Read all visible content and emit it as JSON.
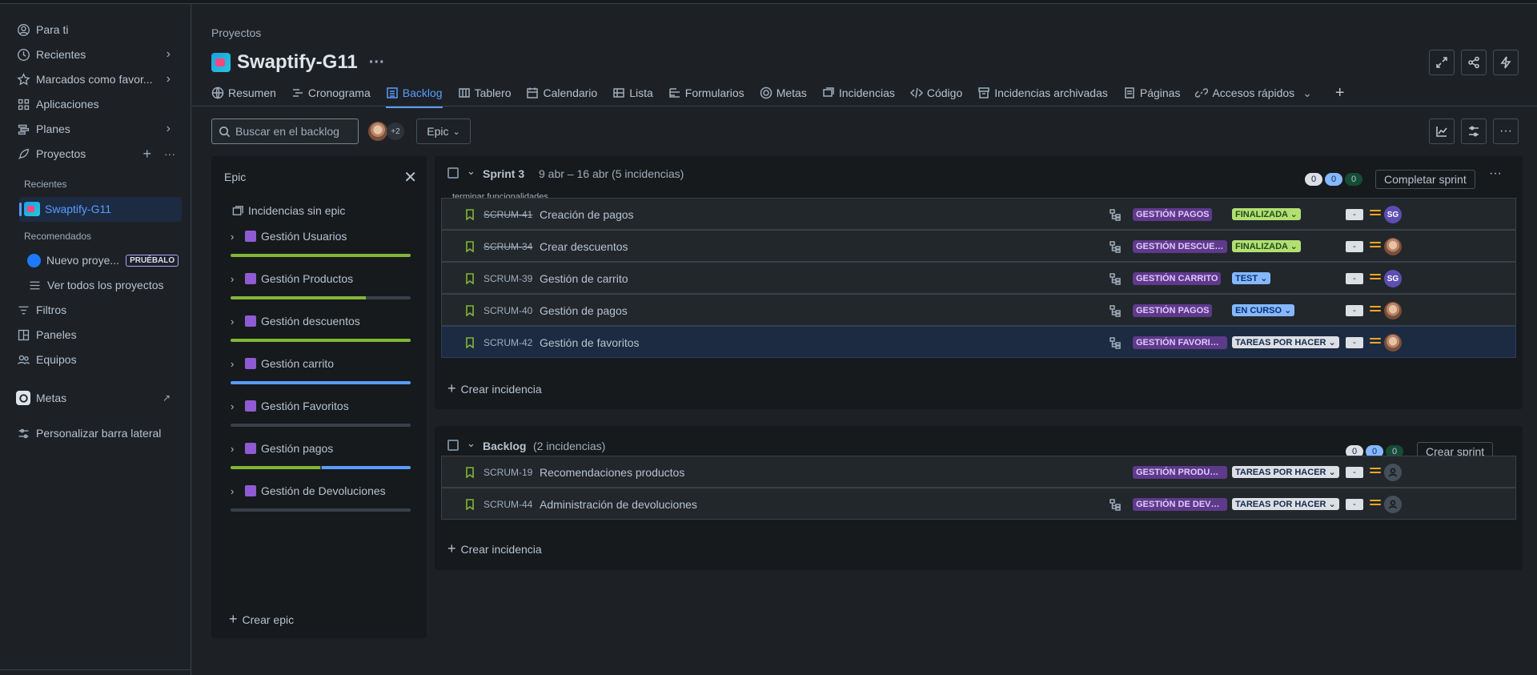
{
  "sidebar": {
    "items": [
      {
        "label": "Para ti",
        "icon": "user-circle-icon"
      },
      {
        "label": "Recientes",
        "icon": "clock-icon"
      },
      {
        "label": "Marcados como favor...",
        "icon": "star-icon"
      },
      {
        "label": "Aplicaciones",
        "icon": "apps-icon"
      },
      {
        "label": "Planes",
        "icon": "plans-icon"
      },
      {
        "label": "Proyectos",
        "icon": "rocket-icon"
      }
    ],
    "recent_label": "Recientes",
    "current_project": "Swaptify-G11",
    "recommended_label": "Recomendados",
    "new_project": "Nuevo proye...",
    "try_badge": "PRUÉBALO",
    "all_projects": "Ver todos los proyectos",
    "filters": "Filtros",
    "dashboards": "Paneles",
    "teams": "Equipos",
    "goals": "Metas",
    "customize": "Personalizar barra lateral"
  },
  "header": {
    "breadcrumb": "Proyectos",
    "title": "Swaptify-G11",
    "more": "···"
  },
  "tabs": [
    {
      "label": "Resumen",
      "icon": "globe-icon"
    },
    {
      "label": "Cronograma",
      "icon": "timeline-icon"
    },
    {
      "label": "Backlog",
      "icon": "backlog-icon",
      "active": true
    },
    {
      "label": "Tablero",
      "icon": "board-icon"
    },
    {
      "label": "Calendario",
      "icon": "calendar-icon"
    },
    {
      "label": "Lista",
      "icon": "list-icon"
    },
    {
      "label": "Formularios",
      "icon": "form-icon"
    },
    {
      "label": "Metas",
      "icon": "target-icon"
    },
    {
      "label": "Incidencias",
      "icon": "issues-icon"
    },
    {
      "label": "Código",
      "icon": "code-icon"
    },
    {
      "label": "Incidencias archivadas",
      "icon": "archive-icon"
    },
    {
      "label": "Páginas",
      "icon": "page-icon"
    },
    {
      "label": "Accesos rápidos",
      "icon": "link-icon"
    }
  ],
  "toolbar": {
    "search_placeholder": "Buscar en el backlog",
    "avatar_extra": "+2",
    "epic_filter": "Epic"
  },
  "epic_panel": {
    "title": "Epic",
    "no_epic": "Incidencias sin epic",
    "epics": [
      {
        "name": "Gestión Usuarios",
        "done": 1.0,
        "in_progress": 0.0
      },
      {
        "name": "Gestión Productos",
        "done": 0.75,
        "in_progress": 0.0
      },
      {
        "name": "Gestión descuentos",
        "done": 1.0,
        "in_progress": 0.0
      },
      {
        "name": "Gestión carrito",
        "done": 0.0,
        "in_progress": 1.0
      },
      {
        "name": "Gestión Favoritos",
        "done": 0.0,
        "in_progress": 0.0
      },
      {
        "name": "Gestión pagos",
        "done": 0.5,
        "in_progress": 0.5
      },
      {
        "name": "Gestión de Devoluciones",
        "done": 0.0,
        "in_progress": 0.0
      }
    ],
    "create_epic": "Crear epic"
  },
  "sprint": {
    "name": "Sprint 3",
    "dates": "9 abr – 16 abr (5 incidencias)",
    "goal": "terminar funcionalidades",
    "counts": [
      "0",
      "0",
      "0"
    ],
    "complete_button": "Completar sprint",
    "more": "···",
    "issues": [
      {
        "key": "SCRUM-41",
        "done": true,
        "summary": "Creación de pagos",
        "epic": "GESTIÓN PAGOS",
        "status": "FINALIZADA",
        "status_type": "done",
        "estimate": "-",
        "assignee": "SG"
      },
      {
        "key": "SCRUM-34",
        "done": true,
        "summary": "Crear descuentos",
        "epic": "GESTIÓN DESCUENTOS",
        "status": "FINALIZADA",
        "status_type": "done",
        "estimate": "-",
        "assignee": "photo"
      },
      {
        "key": "SCRUM-39",
        "done": false,
        "summary": "Gestión de carrito",
        "epic": "GESTIÓN CARRITO",
        "status": "TEST",
        "status_type": "test",
        "estimate": "-",
        "assignee": "SG"
      },
      {
        "key": "SCRUM-40",
        "done": false,
        "summary": "Gestión de pagos",
        "epic": "GESTIÓN PAGOS",
        "status": "EN CURSO",
        "status_type": "prog",
        "estimate": "-",
        "assignee": "photo"
      },
      {
        "key": "SCRUM-42",
        "done": false,
        "summary": "Gestión de favoritos",
        "epic": "GESTIÓN FAVORITOS",
        "status": "TAREAS POR HACER",
        "status_type": "todo",
        "estimate": "-",
        "assignee": "photo"
      }
    ],
    "create_issue": "Crear incidencia"
  },
  "backlog": {
    "name": "Backlog",
    "subtitle": "(2 incidencias)",
    "counts": [
      "0",
      "0",
      "0"
    ],
    "create_sprint": "Crear sprint",
    "issues": [
      {
        "key": "SCRUM-19",
        "done": false,
        "summary": "Recomendaciones productos",
        "epic": "GESTIÓN PRODUCTOS",
        "status": "TAREAS POR HACER",
        "status_type": "todo",
        "estimate": "-",
        "assignee": "none",
        "child": false
      },
      {
        "key": "SCRUM-44",
        "done": false,
        "summary": "Administración de devoluciones",
        "epic": "GESTIÓN DE DEVOLUCI...",
        "status": "TAREAS POR HACER",
        "status_type": "todo",
        "estimate": "-",
        "assignee": "none",
        "child": true
      }
    ],
    "create_issue": "Crear incidencia"
  },
  "colors": {
    "accent": "#579dff",
    "done_green": "#82b536",
    "progress_blue": "#579dff",
    "priority_medium": "#f5a623",
    "epic_purple": "#8f5bd2"
  }
}
